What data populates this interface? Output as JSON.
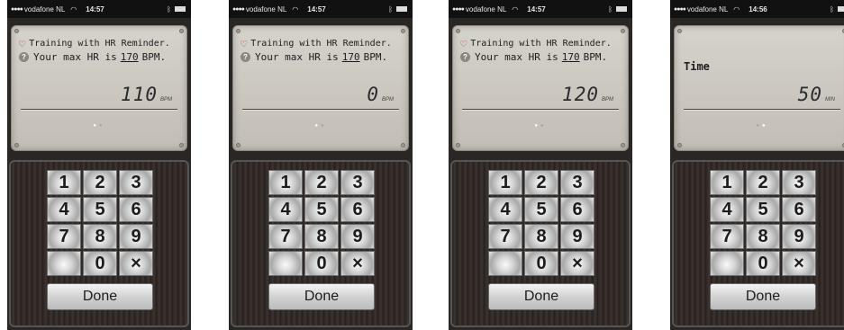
{
  "screens": [
    {
      "status": {
        "signal": "●●●●",
        "carrier": "vodafone NL",
        "wifi_icon": "wifi-icon",
        "time": "14:57"
      },
      "message_line1": "Training with HR Reminder.",
      "message_line2_prefix": "Your max HR is",
      "max_hr": "170",
      "message_line2_suffix": "BPM.",
      "value": "110",
      "unit": "BPM",
      "page_dots": [
        "●",
        "●"
      ],
      "active_page": 0
    },
    {
      "status": {
        "signal": "●●●●",
        "carrier": "vodafone NL",
        "wifi_icon": "wifi-icon",
        "time": "14:57"
      },
      "message_line1": "Training with HR Reminder.",
      "message_line2_prefix": "Your max HR is",
      "max_hr": "170",
      "message_line2_suffix": "BPM.",
      "value": "0",
      "unit": "BPM",
      "page_dots": [
        "●",
        "●"
      ],
      "active_page": 0
    },
    {
      "status": {
        "signal": "●●●●",
        "carrier": "vodafone NL",
        "wifi_icon": "wifi-icon",
        "time": "14:57"
      },
      "message_line1": "Training with HR Reminder.",
      "message_line2_prefix": "Your max HR is",
      "max_hr": "170",
      "message_line2_suffix": "BPM.",
      "value": "120",
      "unit": "BPM",
      "page_dots": [
        "●",
        "●"
      ],
      "active_page": 0
    },
    {
      "status": {
        "signal": "●●●●",
        "carrier": "vodafone NL",
        "wifi_icon": "wifi-icon",
        "time": "14:56"
      },
      "label": "Time",
      "value": "50",
      "unit": "MIN",
      "page_dots": [
        "●",
        "●"
      ],
      "active_page": 1
    }
  ],
  "keypad": {
    "keys": [
      "1",
      "2",
      "3",
      "4",
      "5",
      "6",
      "7",
      "8",
      "9",
      "",
      "0",
      "×"
    ],
    "done_label": "Done"
  },
  "colors": {
    "accent_red": "#a21c1c",
    "heart_red": "#c8262a",
    "display_bg": "#cbc7bf"
  }
}
